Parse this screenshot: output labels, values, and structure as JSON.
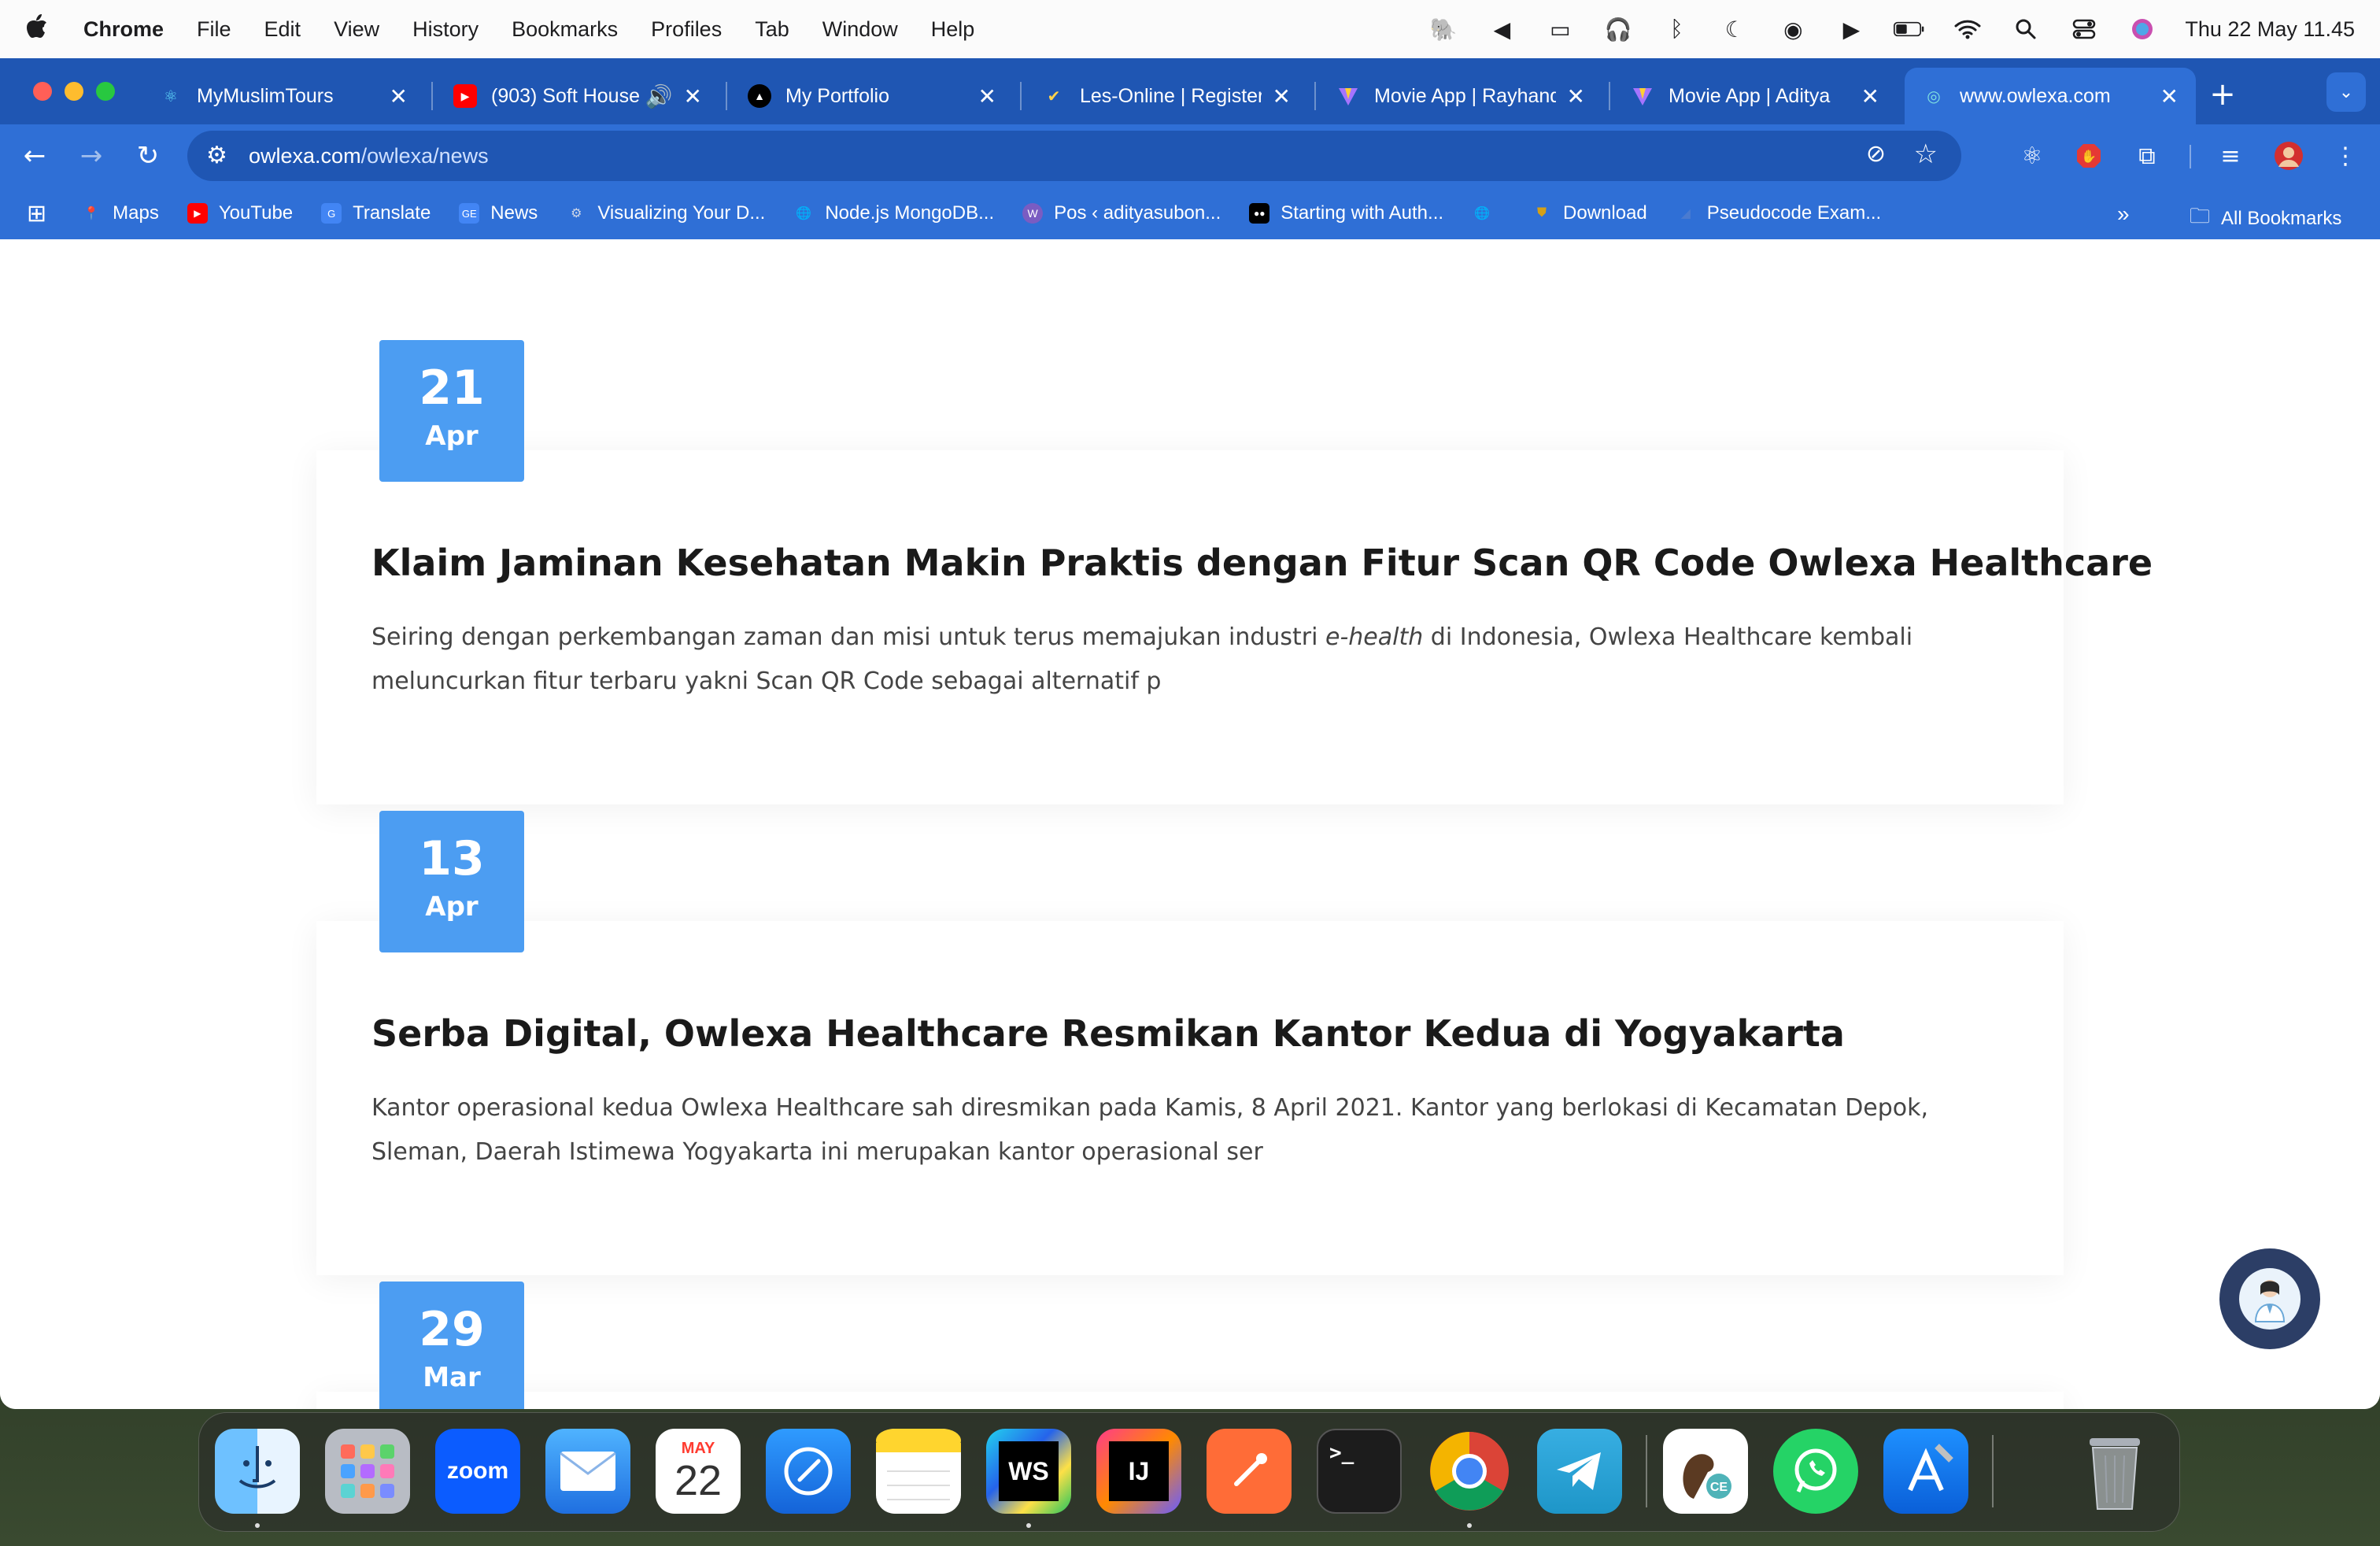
{
  "menubar": {
    "apple": "",
    "items": [
      "Chrome",
      "File",
      "Edit",
      "View",
      "History",
      "Bookmarks",
      "Profiles",
      "Tab",
      "Window",
      "Help"
    ],
    "datetime": "Thu 22 May  11.45"
  },
  "tabs": [
    {
      "title": "MyMuslimTours",
      "icon": "react-icon"
    },
    {
      "title": "(903) Soft House",
      "icon": "youtube-icon",
      "audio": "🔊"
    },
    {
      "title": "My Portfolio",
      "icon": "triangle-icon"
    },
    {
      "title": "Les-Online | Register",
      "icon": "check-icon"
    },
    {
      "title": "Movie App | Rayhand",
      "icon": "vite-icon"
    },
    {
      "title": "Movie App | Aditya",
      "icon": "vite-icon"
    },
    {
      "title": "www.owlexa.com",
      "icon": "owlexa-icon"
    }
  ],
  "toolbar": {
    "url_host": "owlexa.com",
    "url_path": "/owlexa/news"
  },
  "bookmarks": [
    {
      "label": "Maps",
      "color": "#34a853"
    },
    {
      "label": "YouTube",
      "color": "#ff0000"
    },
    {
      "label": "Translate",
      "color": "#4285f4"
    },
    {
      "label": "News",
      "color": "#4285f4"
    },
    {
      "label": "Visualizing Your D...",
      "color": "#999999"
    },
    {
      "label": "Node.js MongoDB...",
      "color": "#ffffff"
    },
    {
      "label": "Pos ‹ adityasubon...",
      "color": "#7a5cc2"
    },
    {
      "label": "Starting with Auth...",
      "color": "#000000"
    },
    {
      "label": "",
      "color": "#ffffff"
    },
    {
      "label": "Download",
      "color": "#d4a017"
    },
    {
      "label": "Pseudocode Exam...",
      "color": "#4a7bd0"
    }
  ],
  "bookmarks_right": {
    "overflow": "»",
    "all_bookmarks": "All Bookmarks"
  },
  "news": [
    {
      "day": "21",
      "month": "Apr",
      "title": "Klaim Jaminan Kesehatan Makin Praktis dengan Fitur Scan QR Code Owlexa Healthcare",
      "body_pre": "Seiring dengan perkembangan zaman dan misi untuk terus memajukan industri ",
      "body_em": "e-health",
      "body_post": " di Indonesia, Owlexa Healthcare kembali meluncurkan fitur terbaru yakni Scan QR Code sebagai alternatif p"
    },
    {
      "day": "13",
      "month": "Apr",
      "title": "Serba Digital, Owlexa Healthcare Resmikan Kantor Kedua di Yogyakarta",
      "body_pre": "Kantor operasional kedua Owlexa Healthcare sah diresmikan pada Kamis, 8 April 2021. Kantor yang berlokasi di Kecamatan Depok, Sleman, Daerah Istimewa Yogyakarta ini merupakan kantor operasional ser",
      "body_em": "",
      "body_post": ""
    },
    {
      "day": "29",
      "month": "Mar",
      "title": "",
      "body_pre": "",
      "body_em": "",
      "body_post": ""
    }
  ],
  "dock": {
    "zoom_label": "zoom",
    "calendar_month": "MAY",
    "calendar_day": "22",
    "webstorm_label": "WS",
    "intellij_label": "IJ",
    "terminal_label": ">_",
    "ce_label": "CE"
  },
  "colors": {
    "chrome_blue": "#2f6fd6",
    "tab_bar": "#1f56b3",
    "date_badge": "#4c9df2"
  }
}
